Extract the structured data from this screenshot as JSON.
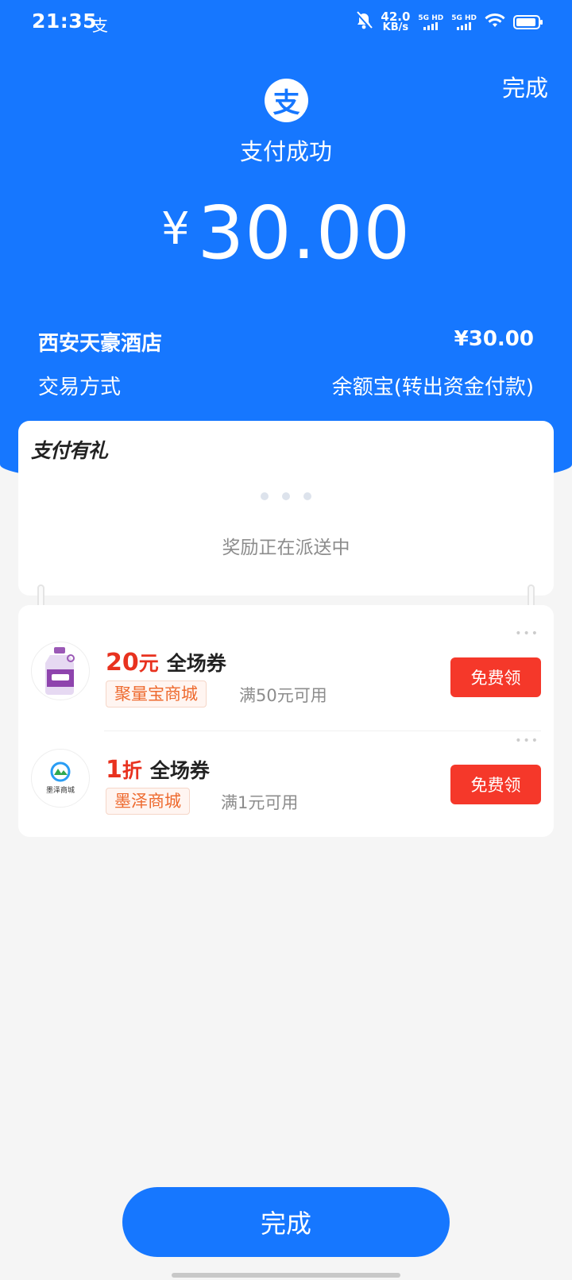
{
  "status_bar": {
    "time": "21:35",
    "app_glyph": "支",
    "net_speed_value": "42.0",
    "net_speed_unit": "KB/s",
    "sim1": "5G HD",
    "sim2": "5G HD",
    "icons": [
      "mute-bell-icon",
      "signal-icon",
      "signal-icon",
      "wifi-icon",
      "battery-icon"
    ]
  },
  "header": {
    "done_label": "完成",
    "logo_glyph": "支",
    "status_text": "支付成功",
    "currency": "¥",
    "amount": "30.00"
  },
  "details": {
    "merchant": "西安天豪酒店",
    "merchant_amount": "¥30.00",
    "method_label": "交易方式",
    "method_value": "余额宝(转出资金付款)"
  },
  "reward_card": {
    "title": "支付有礼",
    "status": "奖励正在派送中"
  },
  "coupons": [
    {
      "value": "20",
      "unit": "元",
      "kind": "全场券",
      "shop": "聚量宝商城",
      "condition": "满50元可用",
      "button": "免费领"
    },
    {
      "value": "1",
      "unit": "折",
      "kind": "全场券",
      "shop": "墨泽商城",
      "condition": "满1元可用",
      "button": "免费领",
      "logo_text": "墨泽商城"
    }
  ],
  "footer": {
    "done_label": "完成"
  },
  "colors": {
    "brand_blue": "#1677ff",
    "coupon_red": "#e8321f",
    "button_red": "#f5382a",
    "shop_orange": "#ee6a2f"
  }
}
